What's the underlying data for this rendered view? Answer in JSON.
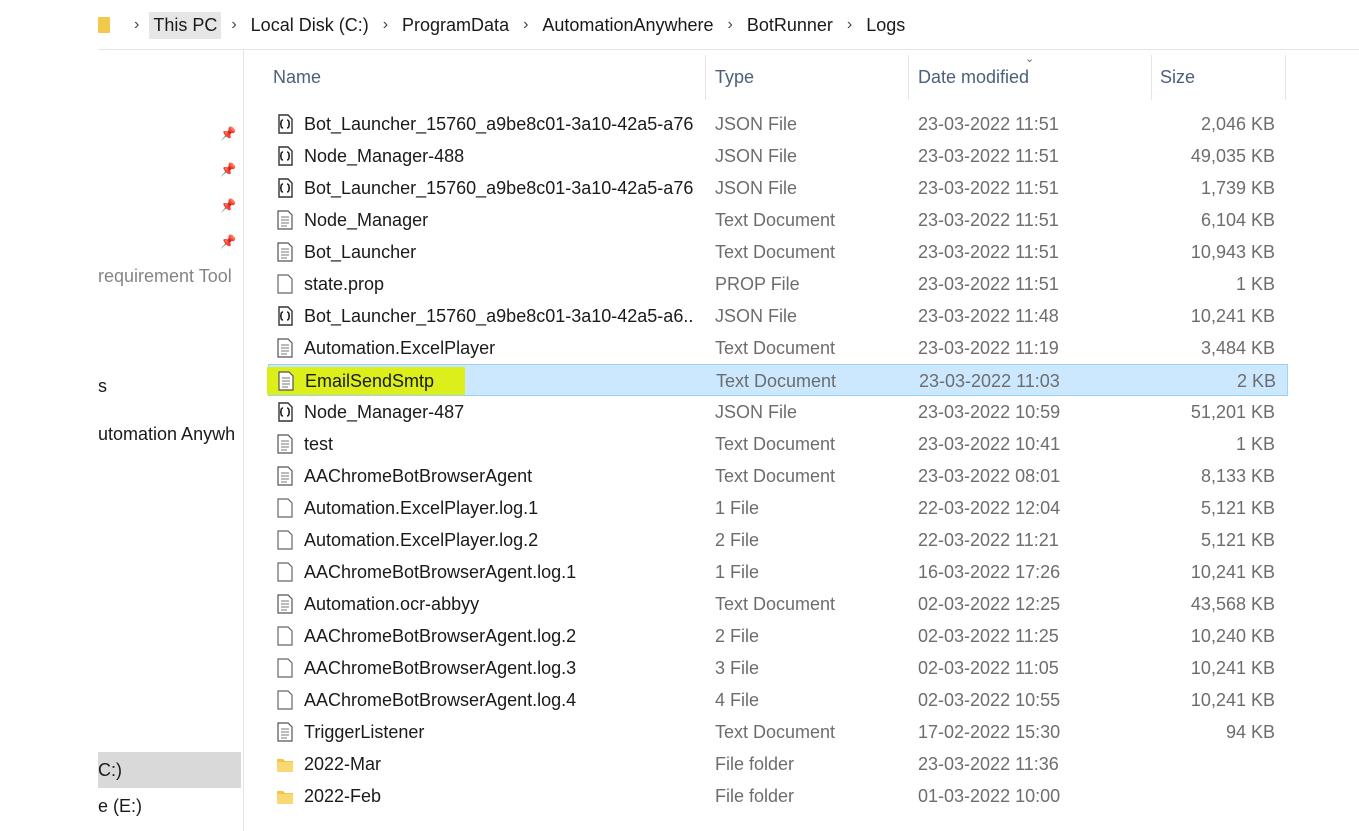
{
  "breadcrumb": [
    "This PC",
    "Local Disk (C:)",
    "ProgramData",
    "AutomationAnywhere",
    "BotRunner",
    "Logs"
  ],
  "nav_pane": {
    "items": [
      {
        "label": "requirement Tool",
        "icon": "folder-icon"
      },
      {
        "label": "s",
        "icon": "folder-icon"
      },
      {
        "label": "utomation Anywh",
        "icon": "folder-icon"
      },
      {
        "label": "C:)",
        "icon": "drive-icon",
        "selected": true
      },
      {
        "label": "e (E:)",
        "icon": "drive-icon"
      }
    ]
  },
  "columns": {
    "name": "Name",
    "type": "Type",
    "date": "Date modified",
    "size": "Size"
  },
  "files": [
    {
      "name": "Bot_Launcher_15760_a9be8c01-3a10-42a5-a76...",
      "type": "JSON File",
      "date": "23-03-2022 11:51",
      "size": "2,046 KB",
      "icon": "json-file-icon"
    },
    {
      "name": "Node_Manager-488",
      "type": "JSON File",
      "date": "23-03-2022 11:51",
      "size": "49,035 KB",
      "icon": "json-file-icon"
    },
    {
      "name": "Bot_Launcher_15760_a9be8c01-3a10-42a5-a76...",
      "type": "JSON File",
      "date": "23-03-2022 11:51",
      "size": "1,739 KB",
      "icon": "json-file-icon"
    },
    {
      "name": "Node_Manager",
      "type": "Text Document",
      "date": "23-03-2022 11:51",
      "size": "6,104 KB",
      "icon": "text-file-icon"
    },
    {
      "name": "Bot_Launcher",
      "type": "Text Document",
      "date": "23-03-2022 11:51",
      "size": "10,943 KB",
      "icon": "text-file-icon"
    },
    {
      "name": "state.prop",
      "type": "PROP File",
      "date": "23-03-2022 11:51",
      "size": "1 KB",
      "icon": "blank-file-icon"
    },
    {
      "name": "Bot_Launcher_15760_a9be8c01-3a10-42a5-a6...",
      "type": "JSON File",
      "date": "23-03-2022 11:48",
      "size": "10,241 KB",
      "icon": "json-file-icon"
    },
    {
      "name": "Automation.ExcelPlayer",
      "type": "Text Document",
      "date": "23-03-2022 11:19",
      "size": "3,484 KB",
      "icon": "text-file-icon"
    },
    {
      "name": "EmailSendSmtp",
      "type": "Text Document",
      "date": "23-03-2022 11:03",
      "size": "2 KB",
      "icon": "text-file-icon",
      "selected": true
    },
    {
      "name": "Node_Manager-487",
      "type": "JSON File",
      "date": "23-03-2022 10:59",
      "size": "51,201 KB",
      "icon": "json-file-icon"
    },
    {
      "name": "test",
      "type": "Text Document",
      "date": "23-03-2022 10:41",
      "size": "1 KB",
      "icon": "text-file-icon"
    },
    {
      "name": "AAChromeBotBrowserAgent",
      "type": "Text Document",
      "date": "23-03-2022 08:01",
      "size": "8,133 KB",
      "icon": "text-file-icon"
    },
    {
      "name": "Automation.ExcelPlayer.log.1",
      "type": "1 File",
      "date": "22-03-2022 12:04",
      "size": "5,121 KB",
      "icon": "blank-file-icon"
    },
    {
      "name": "Automation.ExcelPlayer.log.2",
      "type": "2 File",
      "date": "22-03-2022 11:21",
      "size": "5,121 KB",
      "icon": "blank-file-icon"
    },
    {
      "name": "AAChromeBotBrowserAgent.log.1",
      "type": "1 File",
      "date": "16-03-2022 17:26",
      "size": "10,241 KB",
      "icon": "blank-file-icon"
    },
    {
      "name": "Automation.ocr-abbyy",
      "type": "Text Document",
      "date": "02-03-2022 12:25",
      "size": "43,568 KB",
      "icon": "text-file-icon"
    },
    {
      "name": "AAChromeBotBrowserAgent.log.2",
      "type": "2 File",
      "date": "02-03-2022 11:25",
      "size": "10,240 KB",
      "icon": "blank-file-icon"
    },
    {
      "name": "AAChromeBotBrowserAgent.log.3",
      "type": "3 File",
      "date": "02-03-2022 11:05",
      "size": "10,241 KB",
      "icon": "blank-file-icon"
    },
    {
      "name": "AAChromeBotBrowserAgent.log.4",
      "type": "4 File",
      "date": "02-03-2022 10:55",
      "size": "10,241 KB",
      "icon": "blank-file-icon"
    },
    {
      "name": "TriggerListener",
      "type": "Text Document",
      "date": "17-02-2022 15:30",
      "size": "94 KB",
      "icon": "text-file-icon"
    },
    {
      "name": "2022-Mar",
      "type": "File folder",
      "date": "23-03-2022 11:36",
      "size": "",
      "icon": "folder-icon"
    },
    {
      "name": "2022-Feb",
      "type": "File folder",
      "date": "01-03-2022 10:00",
      "size": "",
      "icon": "folder-icon"
    }
  ],
  "colors": {
    "selection": "#cce8ff",
    "selection_border": "#99d1ff",
    "highlight": "#dcef1a",
    "folder": "#f2c94c",
    "header_text": "#4c607a"
  }
}
